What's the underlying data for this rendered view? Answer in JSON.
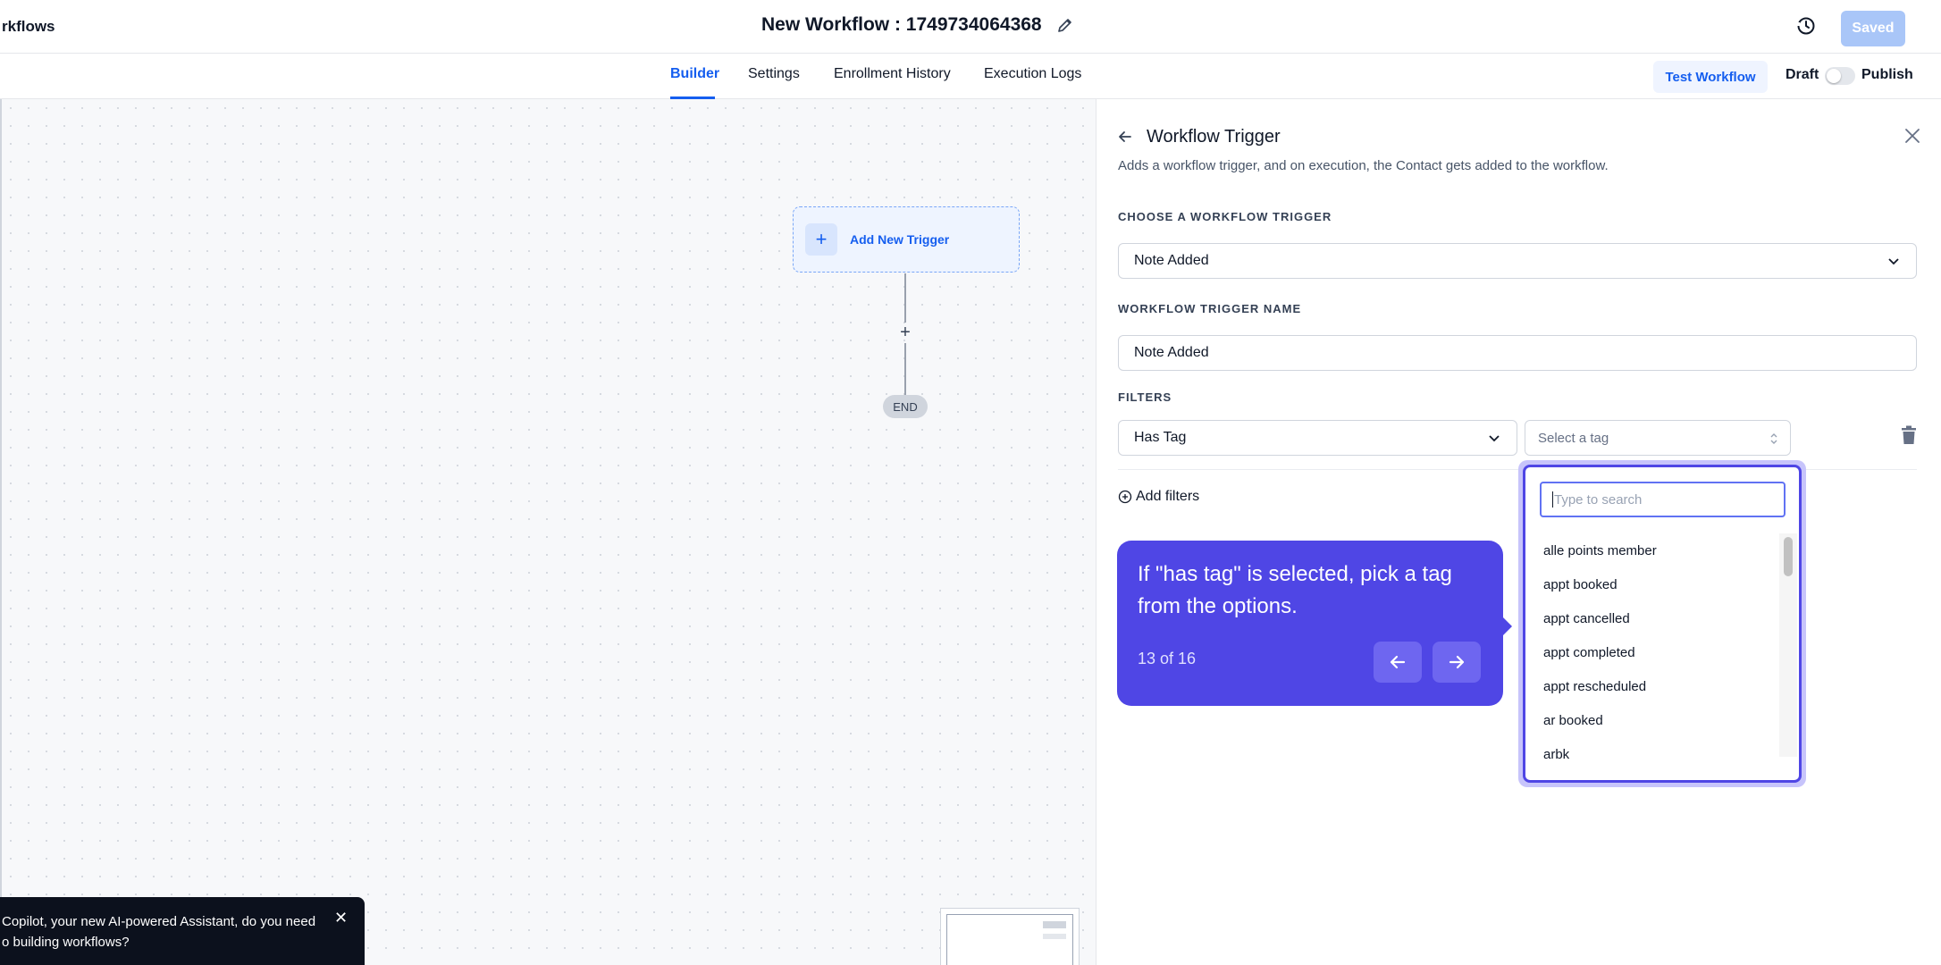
{
  "header": {
    "back_title": "rkflows",
    "workflow_title": "New Workflow : 1749734064368",
    "saved_label": "Saved"
  },
  "tabs": [
    {
      "label": "Builder",
      "active": true
    },
    {
      "label": "Settings",
      "active": false
    },
    {
      "label": "Enrollment History",
      "active": false
    },
    {
      "label": "Execution Logs",
      "active": false
    }
  ],
  "toolbar": {
    "test_label": "Test Workflow",
    "draft_label": "Draft",
    "publish_label": "Publish",
    "published": false
  },
  "canvas": {
    "trigger_label": "Add New Trigger",
    "end_label": "END"
  },
  "copilot": {
    "line1": "Copilot, your new AI-powered Assistant, do you need",
    "line2": "o building workflows?"
  },
  "panel": {
    "title": "Workflow Trigger",
    "description": "Adds a workflow trigger, and on execution, the Contact gets added to the workflow.",
    "choose_label": "CHOOSE A WORKFLOW TRIGGER",
    "trigger_value": "Note Added",
    "name_label": "WORKFLOW TRIGGER NAME",
    "name_value": "Note Added",
    "filters_label": "FILTERS",
    "filter_value": "Has Tag",
    "tag_placeholder": "Select a tag",
    "add_filters_label": "Add filters"
  },
  "tour": {
    "text": "If \"has tag\" is selected, pick a tag from the options.",
    "progress": "13 of 16"
  },
  "tag_dropdown": {
    "search_placeholder": "Type to search",
    "options": [
      "alle points member",
      "appt booked",
      "appt cancelled",
      "appt completed",
      "appt rescheduled",
      "ar booked",
      "arbk"
    ]
  },
  "colors": {
    "accent": "#155eef",
    "tour": "#4f46e5"
  }
}
